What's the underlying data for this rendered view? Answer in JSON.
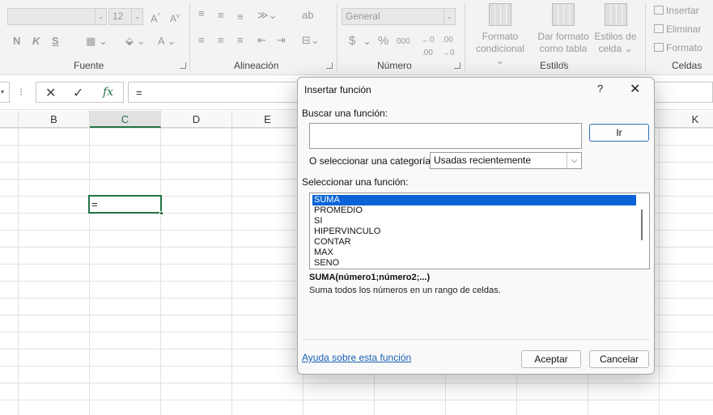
{
  "ribbon": {
    "groups": {
      "fuente": "Fuente",
      "alineacion": "Alineación",
      "numero": "Número",
      "estilos": "Estilos",
      "celdas": "Celdas"
    },
    "font_size": "12",
    "number_format": "General",
    "bold": "N",
    "italic": "K",
    "underline": "S",
    "currency": "$",
    "percent": "%",
    "thousands": "000",
    "conditional_format_1": "Formato",
    "conditional_format_2": "condicional",
    "table_format_1": "Dar formato",
    "table_format_2": "como tabla",
    "cell_styles_1": "Estilos de",
    "cell_styles_2": "celda",
    "insert": "Insertar",
    "delete": "Eliminar",
    "format": "Formato"
  },
  "formula_bar": {
    "content": "=",
    "cancel": "✕",
    "enter": "✓",
    "fx": "fx"
  },
  "grid": {
    "columns": [
      "B",
      "C",
      "D",
      "E",
      "K"
    ],
    "active_cell_value": "="
  },
  "dialog": {
    "title": "Insertar función",
    "help": "?",
    "close": "✕",
    "search_label": "Buscar una función:",
    "search_value": "",
    "go_button": "Ir",
    "category_label": "O seleccionar una categoría:",
    "category_value": "Usadas recientemente",
    "function_label": "Seleccionar una función:",
    "functions": [
      "SUMA",
      "PROMEDIO",
      "SI",
      "HIPERVINCULO",
      "CONTAR",
      "MAX",
      "SENO"
    ],
    "signature": "SUMA(número1;número2;...)",
    "description": "Suma todos los números en un rango de celdas.",
    "help_link": "Ayuda sobre esta función",
    "ok_button": "Aceptar",
    "cancel_button": "Cancelar"
  }
}
